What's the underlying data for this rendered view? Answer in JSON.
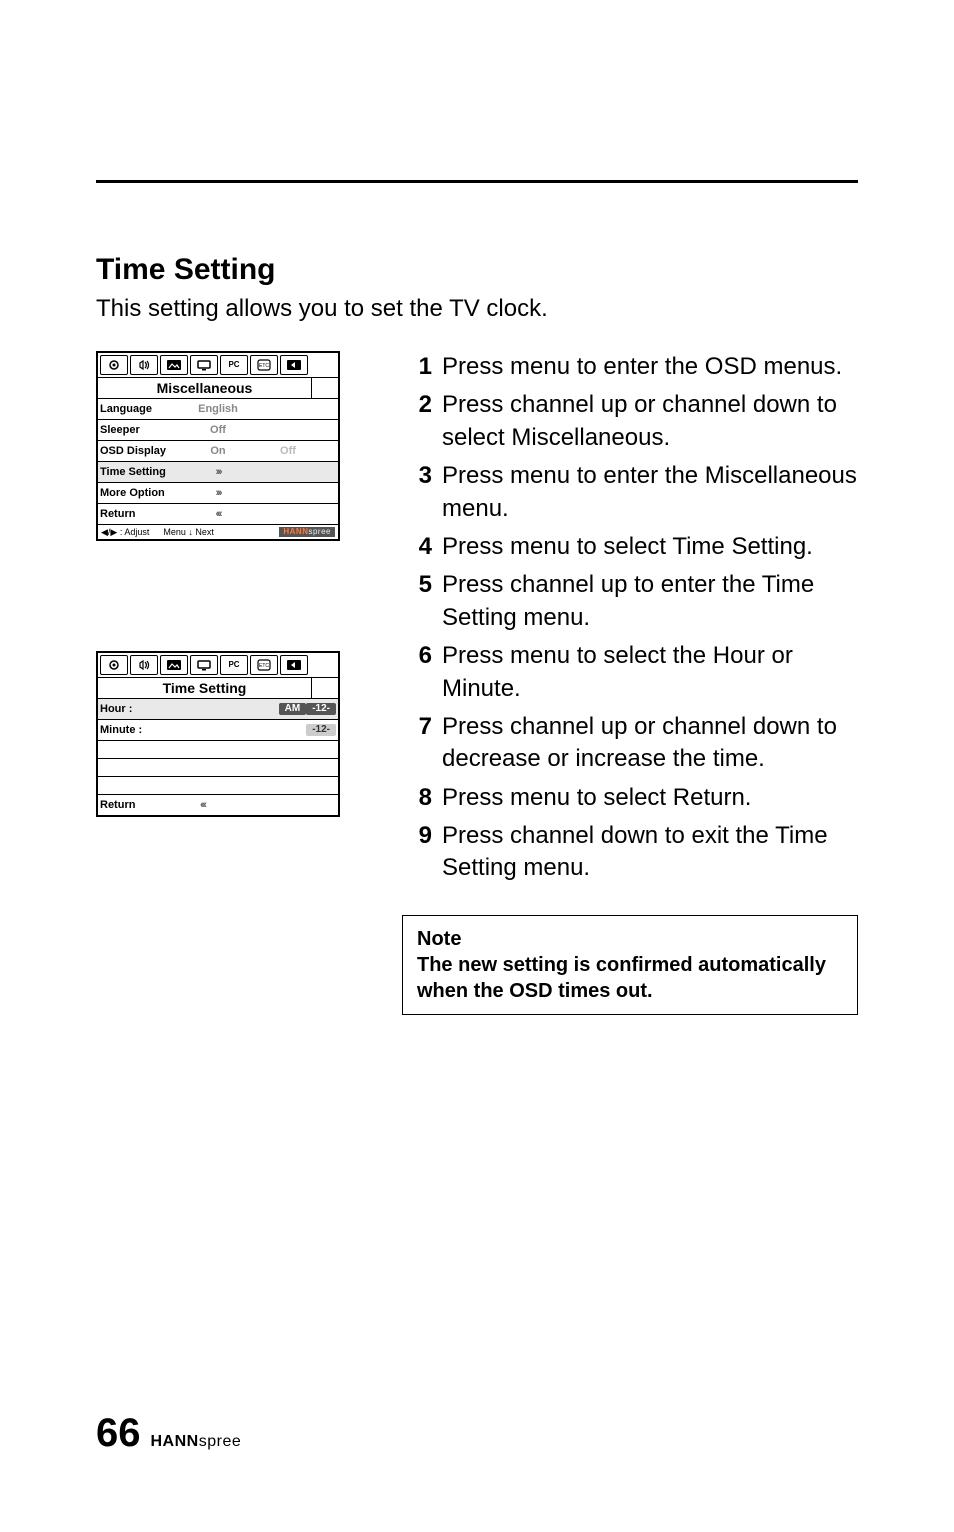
{
  "section": {
    "title": "Time Setting",
    "intro": "This setting allows you to set the TV clock."
  },
  "osd1": {
    "tabs_pc_label": "PC",
    "header": "Miscellaneous",
    "rows": {
      "language": {
        "label": "Language",
        "value": "English"
      },
      "sleeper": {
        "label": "Sleeper",
        "value": "Off"
      },
      "osd_display": {
        "label": "OSD Display",
        "value": "On",
        "value2": "Off"
      },
      "time_setting": {
        "label": "Time Setting",
        "value": "›››"
      },
      "more_option": {
        "label": "More Option",
        "value": "›››"
      },
      "return": {
        "label": "Return",
        "value": "‹‹‹"
      }
    },
    "footer": {
      "adjust": "◀/▶ : Adjust",
      "menu_next": "Menu ↓ Next",
      "brand_prefix": "HANN",
      "brand_suffix": "spree"
    }
  },
  "osd2": {
    "tabs_pc_label": "PC",
    "header": "Time Setting",
    "hour": {
      "label": "Hour    :",
      "ampm": "AM",
      "value": "-12-"
    },
    "minute": {
      "label": "Minute :",
      "value": "-12-"
    },
    "return": {
      "label": "Return",
      "value": "‹‹‹"
    }
  },
  "steps": [
    "Press menu to enter the OSD menus.",
    "Press channel up or channel down to select Miscellaneous.",
    "Press menu to enter the Miscellaneous menu.",
    "Press menu to select Time Setting.",
    "Press channel up to enter the Time Setting menu.",
    "Press menu to select the Hour or Minute.",
    "Press channel up or channel down to decrease or increase the time.",
    "Press menu to select Return.",
    "Press channel down to exit the Time Setting menu."
  ],
  "note": {
    "title": "Note",
    "body": "The new setting is confirmed automatically when the OSD times out."
  },
  "footer": {
    "page_number": "66",
    "brand_bold": "HANN",
    "brand_rest": "spree"
  }
}
